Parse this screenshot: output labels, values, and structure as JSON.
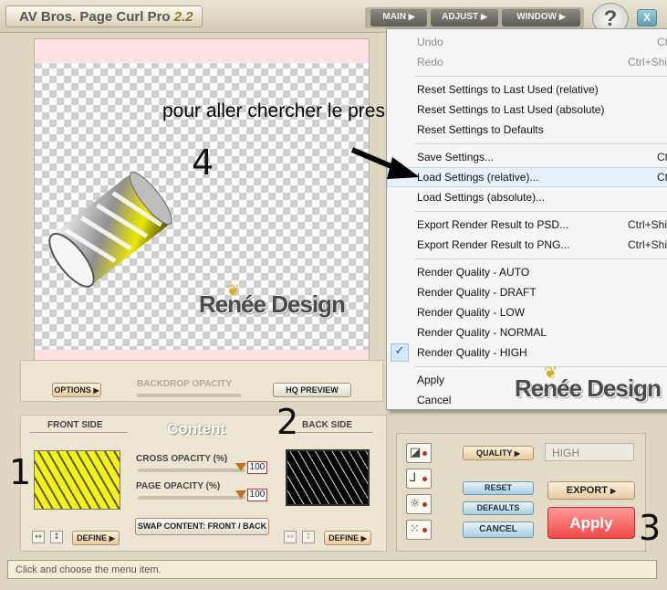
{
  "app": {
    "title": "AV Bros. Page Curl Pro",
    "version": "2.2"
  },
  "topmenu": {
    "main": "MAIN",
    "adjust": "ADJUST",
    "window": "WINDOW",
    "help": "?",
    "close": "X"
  },
  "preview_bar": {
    "options": "OPTIONS",
    "backdrop_opacity": "BACKDROP OPACITY",
    "hq_preview": "HQ PREVIEW"
  },
  "content_panel": {
    "front_side": "FRONT SIDE",
    "heading": "Content",
    "back_side": "BACK SIDE",
    "cross_opacity_label": "CROSS OPACITY (%)",
    "cross_opacity_value": "100",
    "page_opacity_label": "PAGE OPACITY (%)",
    "page_opacity_value": "100",
    "swap_button": "SWAP CONTENT: FRONT / BACK",
    "define_front": "DEFINE",
    "define_back": "DEFINE"
  },
  "right_panel": {
    "quality_label": "QUALITY",
    "quality_value": "HIGH",
    "reset": "RESET",
    "defaults": "DEFAULTS",
    "cancel": "CANCEL",
    "export": "EXPORT",
    "apply": "Apply"
  },
  "status": {
    "text": "Click and choose the menu item."
  },
  "context_menu": {
    "undo": {
      "label": "Undo",
      "shortcut": "Ct"
    },
    "redo": {
      "label": "Redo",
      "shortcut": "Ctrl+Shi"
    },
    "reset_relative": "Reset Settings to Last Used (relative)",
    "reset_absolute": "Reset Settings to Last Used (absolute)",
    "reset_defaults": "Reset Settings to Defaults",
    "save_settings": {
      "label": "Save Settings...",
      "shortcut": "Ct"
    },
    "load_relative": {
      "label": "Load Settings (relative)...",
      "shortcut": "Ct"
    },
    "load_absolute": "Load Settings (absolute)...",
    "export_psd": {
      "label": "Export Render Result to PSD...",
      "shortcut": "Ctrl+Shi"
    },
    "export_png": {
      "label": "Export Render Result to PNG...",
      "shortcut": "Ctrl+Shi"
    },
    "rq_auto": "Render Quality - AUTO",
    "rq_draft": "Render Quality - DRAFT",
    "rq_low": "Render Quality - LOW",
    "rq_normal": "Render Quality - NORMAL",
    "rq_high": "Render Quality - HIGH",
    "apply": "Apply",
    "cancel": "Cancel"
  },
  "annotations": {
    "caption": "pour aller chercher le preset",
    "n1": "1",
    "n2": "2",
    "n3": "3",
    "n4": "4",
    "watermark": "Renée Design"
  },
  "colors": {
    "apply": "#f04848",
    "accent": "#8a7b2c"
  }
}
